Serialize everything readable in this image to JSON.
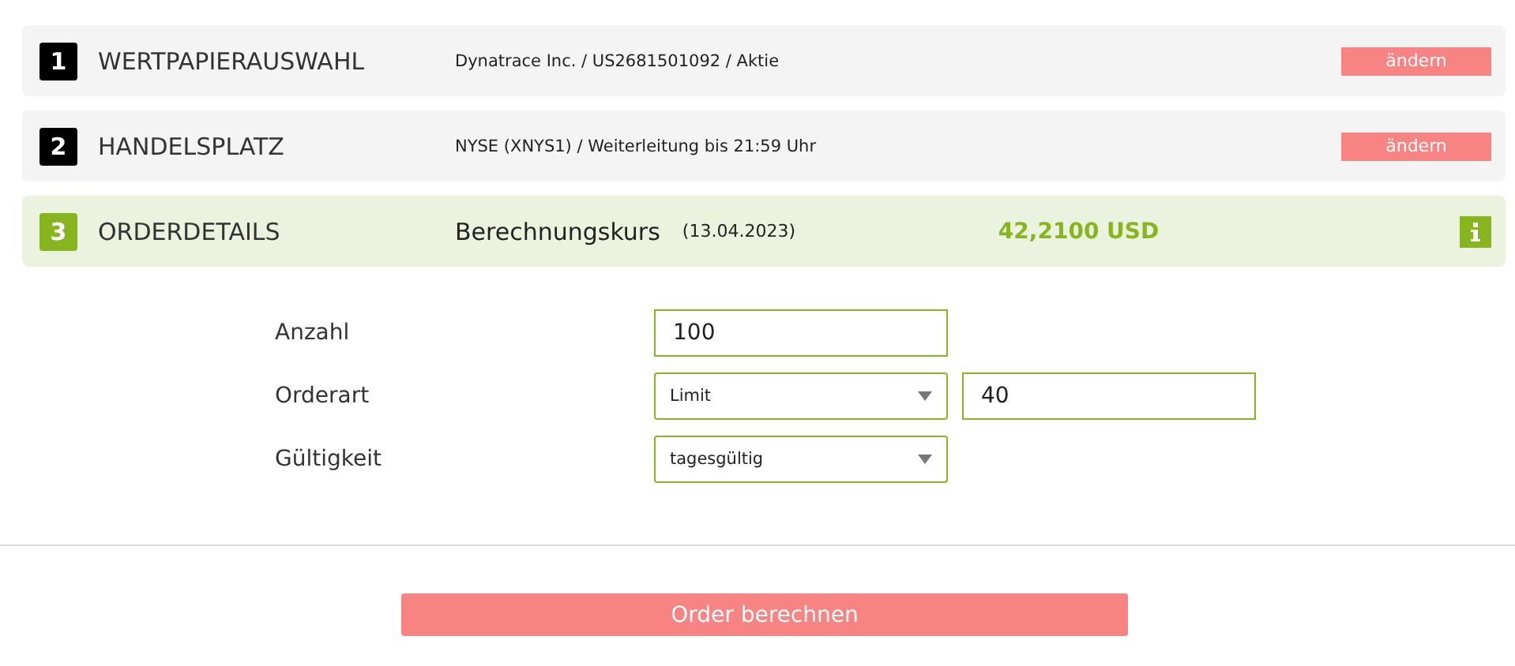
{
  "steps": [
    {
      "number": "1",
      "title": "WERTPAPIERAUSWAHL",
      "detail": "Dynatrace Inc. / US2681501092 / Aktie",
      "action": "ändern",
      "selected": false
    },
    {
      "number": "2",
      "title": "HANDELSPLATZ",
      "detail": "NYSE (XNYS1) / Weiterleitung bis 21:59 Uhr",
      "action": "ändern",
      "selected": false
    },
    {
      "number": "3",
      "title": "ORDERDETAILS",
      "detail": "Berechnungskurs",
      "date": "(13.04.2023)",
      "price": "42,2100 USD",
      "selected": true
    }
  ],
  "form": [
    {
      "label": "Anzahl",
      "controls": [
        {
          "kind": "input",
          "value": "100"
        }
      ]
    },
    {
      "label": "Orderart",
      "controls": [
        {
          "kind": "select",
          "value": "Limit"
        },
        {
          "kind": "input",
          "value": "40"
        }
      ]
    },
    {
      "label": "Gültigkeit",
      "controls": [
        {
          "kind": "select",
          "value": "tagesgültig"
        }
      ]
    }
  ],
  "submit": "Order berechnen"
}
